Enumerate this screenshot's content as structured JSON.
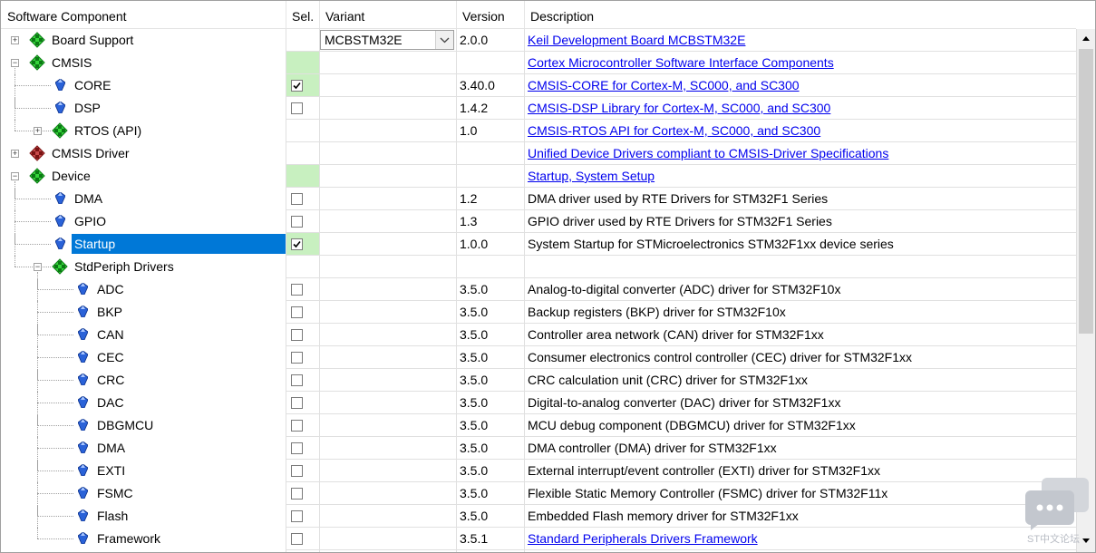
{
  "header": {
    "component": "Software Component",
    "sel": "Sel.",
    "variant": "Variant",
    "version": "Version",
    "description": "Description"
  },
  "rows": [
    {
      "name": "Board Support",
      "level": 0,
      "icon": "green-diamond-icon",
      "expand": "+",
      "selected": false,
      "sel_state": "none",
      "variant": "MCBSTM32E",
      "version": "2.0.0",
      "description": "Keil Development Board MCBSTM32E",
      "link": true
    },
    {
      "name": "CMSIS",
      "level": 0,
      "icon": "green-diamond-icon",
      "expand": "-",
      "selected": false,
      "sel_state": "green",
      "variant": "",
      "version": "",
      "description": "Cortex Microcontroller Software Interface Components",
      "link": true
    },
    {
      "name": "CORE",
      "level": 1,
      "icon": "blue-gem-icon",
      "expand": "",
      "selected": false,
      "sel_state": "checked-green",
      "variant": "",
      "version": "3.40.0",
      "description": "CMSIS-CORE for Cortex-M, SC000, and SC300",
      "link": true
    },
    {
      "name": "DSP",
      "level": 1,
      "icon": "blue-gem-icon",
      "expand": "",
      "selected": false,
      "sel_state": "unchecked",
      "variant": "",
      "version": "1.4.2",
      "description": "CMSIS-DSP Library for Cortex-M, SC000, and SC300",
      "link": true
    },
    {
      "name": "RTOS (API)",
      "level": 1,
      "icon": "green-diamond-icon",
      "expand": "+",
      "selected": false,
      "sel_state": "none",
      "variant": "",
      "version": "1.0",
      "description": "CMSIS-RTOS API for Cortex-M, SC000, and SC300",
      "link": true
    },
    {
      "name": "CMSIS Driver",
      "level": 0,
      "icon": "red-diamond-icon",
      "expand": "+",
      "selected": false,
      "sel_state": "none",
      "variant": "",
      "version": "",
      "description": "Unified Device Drivers compliant to CMSIS-Driver Specifications",
      "link": true
    },
    {
      "name": "Device",
      "level": 0,
      "icon": "green-diamond-icon",
      "expand": "-",
      "selected": false,
      "sel_state": "green",
      "variant": "",
      "version": "",
      "description": "Startup, System Setup",
      "link": true
    },
    {
      "name": "DMA",
      "level": 1,
      "icon": "blue-gem-icon",
      "expand": "",
      "selected": false,
      "sel_state": "unchecked",
      "variant": "",
      "version": "1.2",
      "description": "DMA driver used by RTE Drivers for STM32F1 Series",
      "link": false
    },
    {
      "name": "GPIO",
      "level": 1,
      "icon": "blue-gem-icon",
      "expand": "",
      "selected": false,
      "sel_state": "unchecked",
      "variant": "",
      "version": "1.3",
      "description": "GPIO driver used by RTE Drivers for STM32F1 Series",
      "link": false
    },
    {
      "name": "Startup",
      "level": 1,
      "icon": "blue-gem-icon",
      "expand": "",
      "selected": true,
      "sel_state": "checked-green",
      "variant": "",
      "version": "1.0.0",
      "description": "System Startup for STMicroelectronics STM32F1xx device series",
      "link": false
    },
    {
      "name": "StdPeriph Drivers",
      "level": 1,
      "icon": "green-diamond-icon",
      "expand": "-",
      "selected": false,
      "sel_state": "none",
      "variant": "",
      "version": "",
      "description": "",
      "link": false
    },
    {
      "name": "ADC",
      "level": 2,
      "icon": "blue-gem-icon",
      "expand": "",
      "selected": false,
      "sel_state": "unchecked",
      "variant": "",
      "version": "3.5.0",
      "description": "Analog-to-digital converter (ADC) driver for STM32F10x",
      "link": false
    },
    {
      "name": "BKP",
      "level": 2,
      "icon": "blue-gem-icon",
      "expand": "",
      "selected": false,
      "sel_state": "unchecked",
      "variant": "",
      "version": "3.5.0",
      "description": "Backup registers (BKP) driver for STM32F10x",
      "link": false
    },
    {
      "name": "CAN",
      "level": 2,
      "icon": "blue-gem-icon",
      "expand": "",
      "selected": false,
      "sel_state": "unchecked",
      "variant": "",
      "version": "3.5.0",
      "description": "Controller area network (CAN) driver for STM32F1xx",
      "link": false
    },
    {
      "name": "CEC",
      "level": 2,
      "icon": "blue-gem-icon",
      "expand": "",
      "selected": false,
      "sel_state": "unchecked",
      "variant": "",
      "version": "3.5.0",
      "description": "Consumer electronics control controller (CEC) driver for STM32F1xx",
      "link": false
    },
    {
      "name": "CRC",
      "level": 2,
      "icon": "blue-gem-icon",
      "expand": "",
      "selected": false,
      "sel_state": "unchecked",
      "variant": "",
      "version": "3.5.0",
      "description": "CRC calculation unit (CRC) driver for STM32F1xx",
      "link": false
    },
    {
      "name": "DAC",
      "level": 2,
      "icon": "blue-gem-icon",
      "expand": "",
      "selected": false,
      "sel_state": "unchecked",
      "variant": "",
      "version": "3.5.0",
      "description": "Digital-to-analog converter (DAC) driver for STM32F1xx",
      "link": false
    },
    {
      "name": "DBGMCU",
      "level": 2,
      "icon": "blue-gem-icon",
      "expand": "",
      "selected": false,
      "sel_state": "unchecked",
      "variant": "",
      "version": "3.5.0",
      "description": "MCU debug component (DBGMCU) driver for STM32F1xx",
      "link": false
    },
    {
      "name": "DMA",
      "level": 2,
      "icon": "blue-gem-icon",
      "expand": "",
      "selected": false,
      "sel_state": "unchecked",
      "variant": "",
      "version": "3.5.0",
      "description": "DMA controller (DMA) driver for STM32F1xx",
      "link": false
    },
    {
      "name": "EXTI",
      "level": 2,
      "icon": "blue-gem-icon",
      "expand": "",
      "selected": false,
      "sel_state": "unchecked",
      "variant": "",
      "version": "3.5.0",
      "description": "External interrupt/event controller (EXTI) driver for STM32F1xx",
      "link": false
    },
    {
      "name": "FSMC",
      "level": 2,
      "icon": "blue-gem-icon",
      "expand": "",
      "selected": false,
      "sel_state": "unchecked",
      "variant": "",
      "version": "3.5.0",
      "description": "Flexible Static Memory Controller (FSMC) driver for STM32F11x",
      "link": false
    },
    {
      "name": "Flash",
      "level": 2,
      "icon": "blue-gem-icon",
      "expand": "",
      "selected": false,
      "sel_state": "unchecked",
      "variant": "",
      "version": "3.5.0",
      "description": "Embedded Flash memory driver for STM32F1xx",
      "link": false
    },
    {
      "name": "Framework",
      "level": 2,
      "icon": "blue-gem-icon",
      "expand": "",
      "selected": false,
      "sel_state": "unchecked",
      "variant": "",
      "version": "3.5.1",
      "description": "Standard Peripherals Drivers Framework",
      "link": true
    }
  ],
  "watermark": {
    "text": "ST中文论坛"
  },
  "colors": {
    "selection": "#0078d7",
    "sel_green": "#c8f0c0",
    "link": "#0000ee"
  }
}
